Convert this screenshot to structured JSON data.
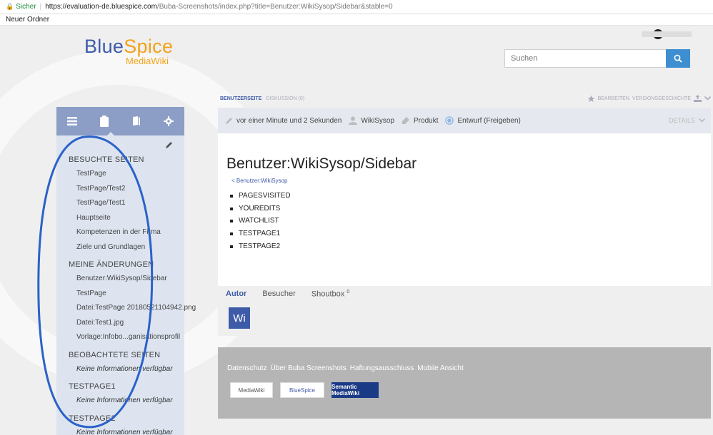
{
  "browser": {
    "secure_label": "Sicher",
    "url_host": "https://evaluation-de.bluespice.com",
    "url_path": "/Buba-Screenshots/index.php?title=Benutzer:WikiSysop/Sidebar&stable=0",
    "bookmark": "Neuer Ordner"
  },
  "logo": {
    "main_a": "Blue",
    "main_b": "Spice",
    "sub": "MediaWiki"
  },
  "search": {
    "placeholder": "Suchen"
  },
  "sidebar": {
    "sections": [
      {
        "title": "BESUCHTE SEITEN",
        "items": [
          "TestPage",
          "TestPage/Test2",
          "TestPage/Test1",
          "Hauptseite",
          "Kompetenzen in der Firma",
          "Ziele und Grundlagen"
        ]
      },
      {
        "title": "MEINE ÄNDERUNGEN",
        "items": [
          "Benutzer:WikiSysop/Sidebar",
          "TestPage",
          "Datei:TestPage 20180521104942.png",
          "Datei:Test1.jpg",
          "Vorlage:Infobo...ganisationsprofil"
        ]
      },
      {
        "title": "BEOBACHTETE SEITEN",
        "items": [
          "Keine Informationen verfügbar"
        ]
      },
      {
        "title": "TESTPAGE1",
        "items": [
          "Keine Informationen verfügbar"
        ]
      },
      {
        "title": "TESTPAGE2",
        "items": [
          "Keine Informationen verfügbar"
        ]
      }
    ]
  },
  "content_tabs": {
    "active": "BENUTZERSEITE",
    "discussion": "DISKUSSION (0)",
    "edit": "BEARBEITEN",
    "history": "VERSIONSGESCHICHTE"
  },
  "meta": {
    "time": "vor einer Minute und 2 Sekunden",
    "user": "WikiSysop",
    "product": "Produkt",
    "status": "Entwurf (Freigeben)",
    "details": "DETAILS"
  },
  "article": {
    "title": "Benutzer:WikiSysop/Sidebar",
    "breadcrumb": "< Benutzer:WikiSysop",
    "bullets": [
      "PAGESVISITED",
      "YOUREDITS",
      "WATCHLIST",
      "TESTPAGE1",
      "TESTPAGE2"
    ]
  },
  "panel": {
    "tab_author": "Autor",
    "tab_visitor": "Besucher",
    "tab_shoutbox": "Shoutbox",
    "shoutbox_count": "0",
    "avatar_initials": "Wi"
  },
  "footer": {
    "links": [
      "Datenschutz",
      "Über Buba Screenshots",
      "Haftungsausschluss",
      "Mobile Ansicht"
    ],
    "badge_mediawiki": "MediaWiki",
    "badge_bluespice": "BlueSpice",
    "badge_smw": "Semantic MediaWiki"
  },
  "colors": {
    "accent": "#3e5ba8",
    "sidebar_bg": "#dde4f0",
    "sidebar_tabs": "#8c9ec6",
    "search_btn": "#3e8fd1",
    "annotation": "#2b62c9"
  }
}
